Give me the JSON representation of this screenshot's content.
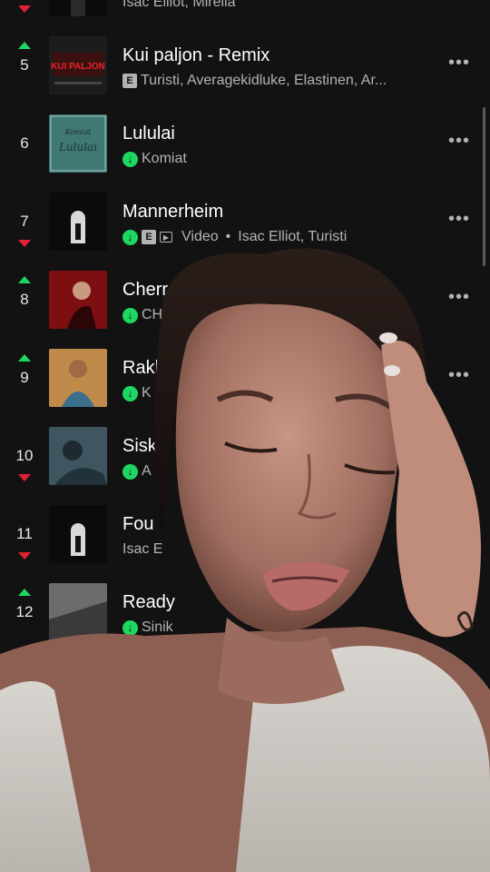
{
  "tracks": [
    {
      "rank": "",
      "trend": "down",
      "title": "",
      "artists": "Isac Elliot, Mirella",
      "explicit": false,
      "downloaded": false,
      "video": false
    },
    {
      "rank": "5",
      "trend": "up",
      "title": "Kui paljon - Remix",
      "artists": "Turisti, Averagekidluke, Elastinen, Ar...",
      "explicit": true,
      "downloaded": false,
      "video": false
    },
    {
      "rank": "6",
      "trend": "none",
      "title": "Lululai",
      "artists": "Komiat",
      "explicit": false,
      "downloaded": true,
      "video": false
    },
    {
      "rank": "7",
      "trend": "down",
      "title": "Mannerheim",
      "artists": "Isac Elliot, Turisti",
      "explicit": true,
      "downloaded": true,
      "video": true,
      "video_label": "Video",
      "separator": "•"
    },
    {
      "rank": "8",
      "trend": "up",
      "title": "Cherr",
      "artists": "CHA",
      "explicit": false,
      "downloaded": true,
      "video": false
    },
    {
      "rank": "9",
      "trend": "up",
      "title": "Rakk",
      "artists": "K",
      "explicit": false,
      "downloaded": true,
      "video": false
    },
    {
      "rank": "10",
      "trend": "down",
      "title": "Sisk",
      "artists": "A",
      "explicit": false,
      "downloaded": true,
      "video": false
    },
    {
      "rank": "11",
      "trend": "down",
      "title": "Fou",
      "artists": "Isac E",
      "explicit": false,
      "downloaded": false,
      "video": false
    },
    {
      "rank": "12",
      "trend": "up",
      "title": "Ready",
      "artists": "Sinik",
      "explicit": false,
      "downloaded": true,
      "video": false
    }
  ],
  "cover_texts": {
    "kui_paljon": "KUI PALJON",
    "lululai_small": "Komiat",
    "lululai_big": "Lululai"
  },
  "icons": {
    "more": "more-options-icon",
    "download": "downloaded-icon",
    "explicit_letter": "E",
    "download_glyph": "↓",
    "video_glyph": "▶",
    "more_glyph": "•••"
  },
  "colors": {
    "background": "#121212",
    "accent": "#1ed760",
    "down": "#e22134"
  }
}
